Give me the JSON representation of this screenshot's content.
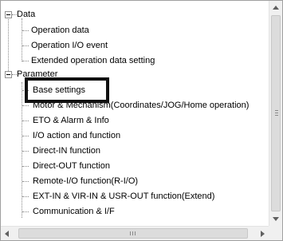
{
  "tree": {
    "root_nodes": [
      {
        "label": "Data",
        "children": [
          {
            "label": "Operation data"
          },
          {
            "label": "Operation I/O event"
          },
          {
            "label": "Extended operation data setting"
          }
        ]
      },
      {
        "label": "Parameter",
        "children": [
          {
            "label": "Base settings"
          },
          {
            "label": "Motor & Mechanism(Coordinates/JOG/Home operation)"
          },
          {
            "label": "ETO & Alarm & Info"
          },
          {
            "label": "I/O action and function"
          },
          {
            "label": "Direct-IN function"
          },
          {
            "label": "Direct-OUT function"
          },
          {
            "label": "Remote-I/O function(R-I/O)"
          },
          {
            "label": "EXT-IN & VIR-IN & USR-OUT function(Extend)"
          },
          {
            "label": "Communication & I/F"
          }
        ]
      }
    ],
    "highlighted_item": "Base settings"
  },
  "icons": {
    "expander": "collapse-minus-icon",
    "scroll_up": "scroll-up-arrow-icon",
    "scroll_down": "scroll-down-arrow-icon",
    "scroll_left": "scroll-left-arrow-icon",
    "scroll_right": "scroll-right-arrow-icon"
  },
  "colors": {
    "highlight_border": "#111111",
    "tree_lines": "#8a8a8a",
    "scrollbar_bg": "#f0f0f0"
  }
}
